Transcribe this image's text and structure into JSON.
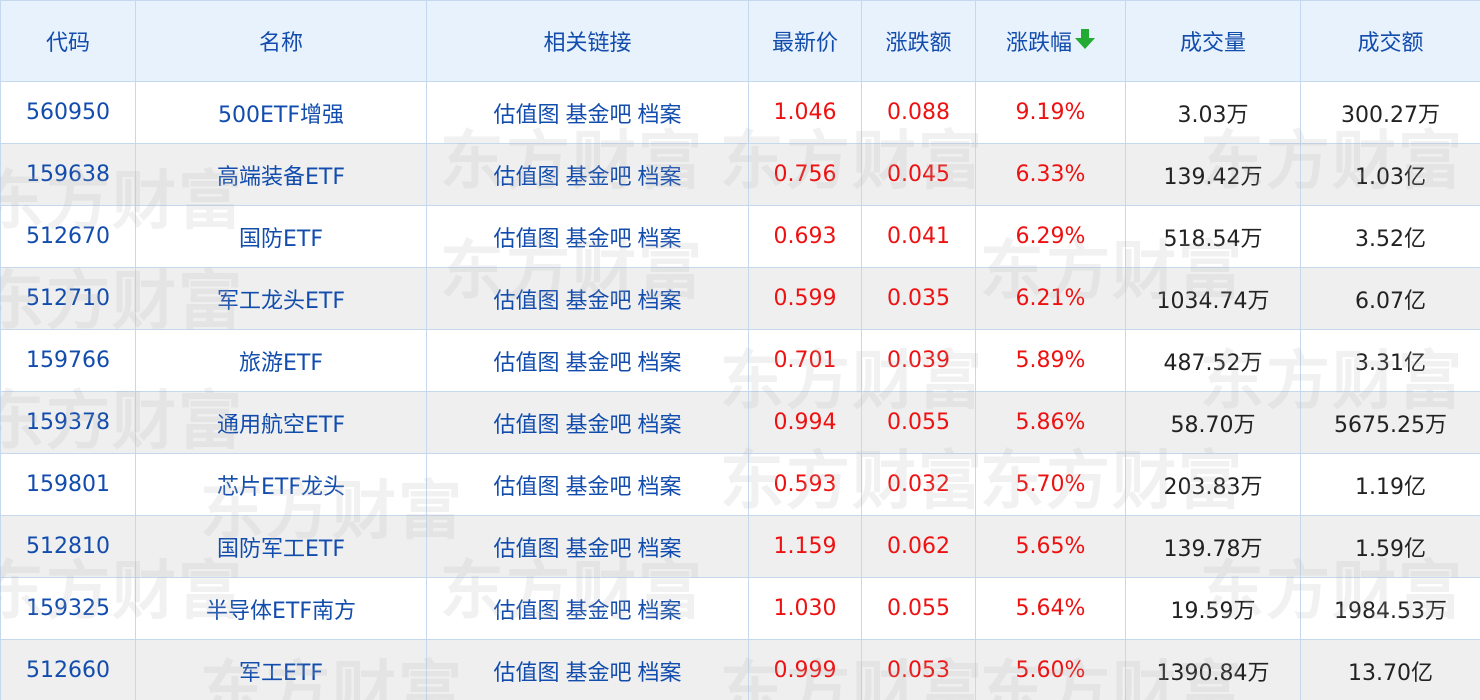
{
  "header": {
    "code": "代码",
    "name": "名称",
    "links": "相关链接",
    "price": "最新价",
    "change": "涨跌额",
    "pct": "涨跌幅",
    "volume": "成交量",
    "turnover": "成交额"
  },
  "sort": {
    "column": "pct",
    "direction": "desc",
    "icon": "arrow-down-icon",
    "color": "#22aa33"
  },
  "link_labels": [
    "估值图",
    "基金吧",
    "档案"
  ],
  "colors": {
    "header_bg": "#e8f2fd",
    "header_text": "#124cad",
    "up": "#ee1111",
    "link": "#124cad"
  },
  "rows": [
    {
      "code": "560950",
      "name": "500ETF增强",
      "price": "1.046",
      "change": "0.088",
      "pct": "9.19%",
      "volume": "3.03万",
      "turnover": "300.27万"
    },
    {
      "code": "159638",
      "name": "高端装备ETF",
      "price": "0.756",
      "change": "0.045",
      "pct": "6.33%",
      "volume": "139.42万",
      "turnover": "1.03亿"
    },
    {
      "code": "512670",
      "name": "国防ETF",
      "price": "0.693",
      "change": "0.041",
      "pct": "6.29%",
      "volume": "518.54万",
      "turnover": "3.52亿"
    },
    {
      "code": "512710",
      "name": "军工龙头ETF",
      "price": "0.599",
      "change": "0.035",
      "pct": "6.21%",
      "volume": "1034.74万",
      "turnover": "6.07亿"
    },
    {
      "code": "159766",
      "name": "旅游ETF",
      "price": "0.701",
      "change": "0.039",
      "pct": "5.89%",
      "volume": "487.52万",
      "turnover": "3.31亿"
    },
    {
      "code": "159378",
      "name": "通用航空ETF",
      "price": "0.994",
      "change": "0.055",
      "pct": "5.86%",
      "volume": "58.70万",
      "turnover": "5675.25万"
    },
    {
      "code": "159801",
      "name": "芯片ETF龙头",
      "price": "0.593",
      "change": "0.032",
      "pct": "5.70%",
      "volume": "203.83万",
      "turnover": "1.19亿"
    },
    {
      "code": "512810",
      "name": "国防军工ETF",
      "price": "1.159",
      "change": "0.062",
      "pct": "5.65%",
      "volume": "139.78万",
      "turnover": "1.59亿"
    },
    {
      "code": "159325",
      "name": "半导体ETF南方",
      "price": "1.030",
      "change": "0.055",
      "pct": "5.64%",
      "volume": "19.59万",
      "turnover": "1984.53万"
    },
    {
      "code": "512660",
      "name": "军工ETF",
      "price": "0.999",
      "change": "0.053",
      "pct": "5.60%",
      "volume": "1390.84万",
      "turnover": "13.70亿"
    }
  ],
  "watermark": {
    "text": "东方财富"
  }
}
